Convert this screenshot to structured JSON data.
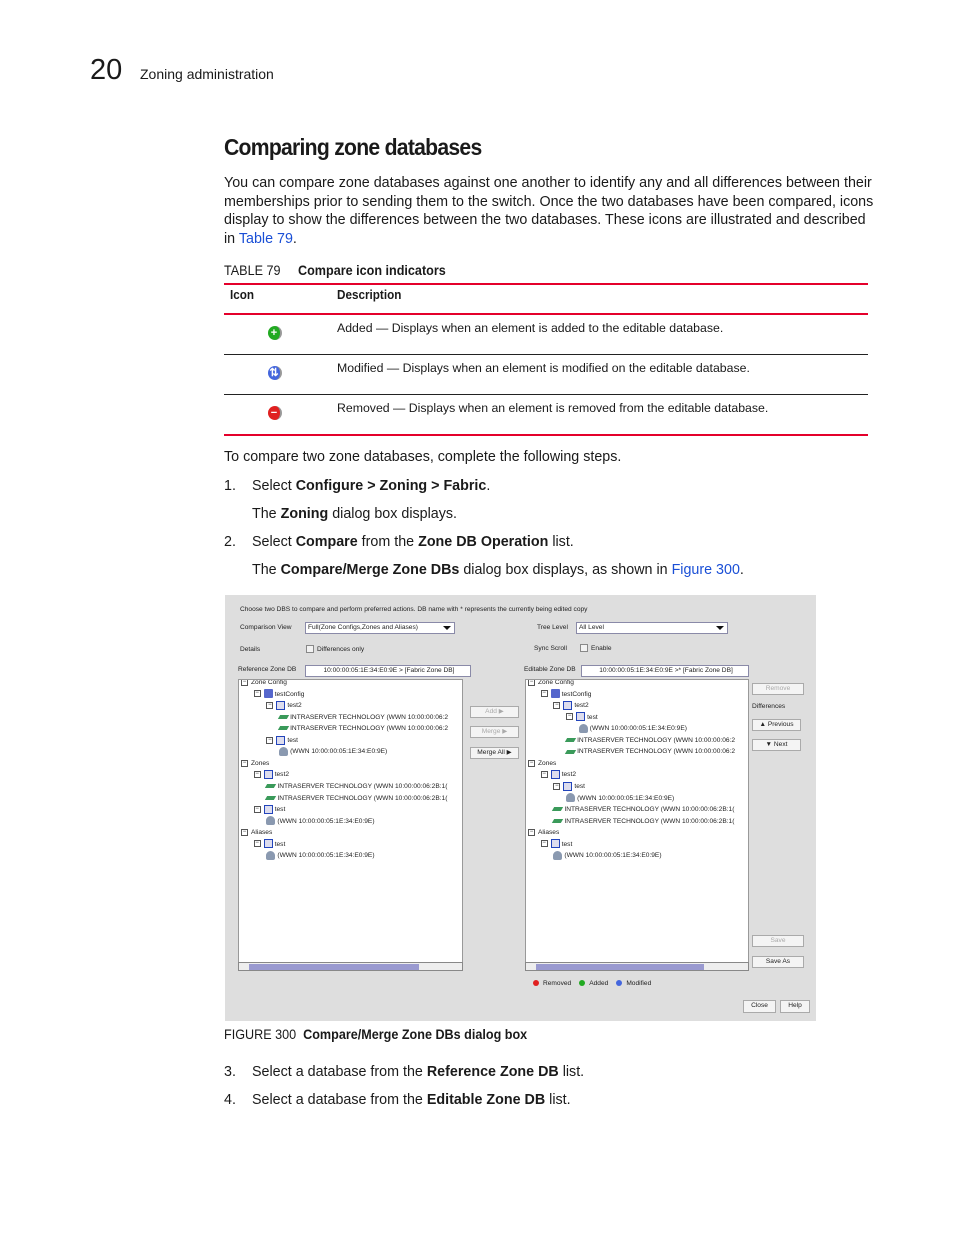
{
  "header": {
    "chapter_number": "20",
    "chapter_title": "Zoning administration"
  },
  "section_title": "Comparing zone databases",
  "intro": {
    "text": "You can compare zone databases against one another to identify any and all differences between their memberships prior to sending them to the switch. Once the two databases have been compared, icons display to show the differences between the two databases. These icons are illustrated and described in ",
    "link": "Table 79",
    "end": "."
  },
  "table": {
    "label": "TABLE 79",
    "title": "Compare icon indicators",
    "headers": [
      "Icon",
      "Description"
    ],
    "rows": [
      {
        "icon": "added-icon",
        "color": "#22aa22",
        "glyph": "+",
        "description": "Added — Displays when an element is added to the editable database."
      },
      {
        "icon": "modified-icon",
        "color": "#4466dd",
        "glyph": "⇅",
        "description": "Modified — Displays when an element is modified on the editable database."
      },
      {
        "icon": "removed-icon",
        "color": "#e02020",
        "glyph": "−",
        "description": "Removed — Displays when an element is removed from the editable database."
      }
    ]
  },
  "steps_intro": "To compare two zone databases, complete the following steps.",
  "steps": [
    {
      "num": "1.",
      "a": "Select ",
      "b": "Configure > Zoning > Fabric",
      "c": "."
    },
    {
      "sub_a": "The ",
      "sub_b": "Zoning",
      "sub_c": " dialog box displays."
    },
    {
      "num": "2.",
      "a": "Select ",
      "b": "Compare",
      "c": " from the ",
      "d": "Zone DB Operation",
      "e": " list."
    },
    {
      "sub_a": "The ",
      "sub_b": "Compare/Merge Zone DBs",
      "sub_c": " dialog box displays, as shown in ",
      "link": "Figure 300",
      "end": "."
    },
    {
      "num": "3.",
      "a": "Select a database from the ",
      "b": "Reference Zone DB",
      "c": " list."
    },
    {
      "num": "4.",
      "a": "Select a database from the ",
      "b": "Editable Zone DB",
      "c": " list."
    }
  ],
  "figure": {
    "label": "FIGURE 300",
    "caption": "Compare/Merge Zone DBs dialog box"
  },
  "dialog": {
    "instruction": "Choose two DBS to compare and perform preferred actions. DB name with * represents the currently being edited copy",
    "comparison_view_label": "Comparison View",
    "comparison_view_value": "Full(Zone Configs,Zones and Aliases)",
    "tree_level_label": "Tree Level",
    "tree_level_value": "All Level",
    "details_label": "Details",
    "differences_only": "Differences only",
    "sync_scroll_label": "Sync Scroll",
    "enable": "Enable",
    "reference_label": "Reference Zone DB",
    "reference_value": "10:00:00:05:1E:34:E0:9E > [Fabric Zone DB]",
    "editable_label": "Editable Zone DB",
    "editable_value": "10:00:00:05:1E:34:E0:9E >*  [Fabric Zone DB]",
    "buttons": {
      "add": "Add ▶",
      "merge": "Merge ▶",
      "merge_all": "Merge All ▶",
      "remove": "Remove",
      "differences": "Differences",
      "previous": "▲ Previous",
      "next": "▼ Next",
      "save": "Save",
      "save_as": "Save As",
      "close": "Close",
      "help": "Help"
    },
    "legend": [
      {
        "label": "Removed",
        "color": "#e02020"
      },
      {
        "label": "Added",
        "color": "#22aa22"
      },
      {
        "label": "Modified",
        "color": "#4466dd"
      }
    ],
    "left_tree": [
      {
        "d": 0,
        "i": "",
        "t": "Zone Config"
      },
      {
        "d": 1,
        "i": "cfg",
        "t": "testConfig"
      },
      {
        "d": 2,
        "i": "zone",
        "t": "test2"
      },
      {
        "d": 3,
        "i": "dev",
        "t": "INTRASERVER TECHNOLOGY (WWN 10:00:00:06:2"
      },
      {
        "d": 3,
        "i": "dev",
        "t": "INTRASERVER TECHNOLOGY (WWN 10:00:00:06:2"
      },
      {
        "d": 2,
        "i": "zone",
        "t": "test"
      },
      {
        "d": 3,
        "i": "host",
        "t": "(WWN 10:00:00:05:1E:34:E0:9E)"
      },
      {
        "d": 0,
        "i": "",
        "t": "Zones"
      },
      {
        "d": 1,
        "i": "zone",
        "t": "test2"
      },
      {
        "d": 2,
        "i": "dev",
        "t": "INTRASERVER TECHNOLOGY (WWN 10:00:00:06:2B:1("
      },
      {
        "d": 2,
        "i": "dev",
        "t": "INTRASERVER TECHNOLOGY (WWN 10:00:00:06:2B:1("
      },
      {
        "d": 1,
        "i": "zone",
        "t": "test"
      },
      {
        "d": 2,
        "i": "host",
        "t": "(WWN 10:00:00:05:1E:34:E0:9E)"
      },
      {
        "d": 0,
        "i": "",
        "t": "Aliases"
      },
      {
        "d": 1,
        "i": "zone",
        "t": "test"
      },
      {
        "d": 2,
        "i": "host",
        "t": "(WWN 10:00:00:05:1E:34:E0:9E)"
      }
    ],
    "right_tree": [
      {
        "d": 0,
        "i": "",
        "t": "Zone Config"
      },
      {
        "d": 1,
        "i": "cfg",
        "t": "testConfig"
      },
      {
        "d": 2,
        "i": "zone",
        "t": "test2"
      },
      {
        "d": 3,
        "i": "zone",
        "t": "test"
      },
      {
        "d": 4,
        "i": "host",
        "t": "(WWN 10:00:00:05:1E:34:E0:9E)"
      },
      {
        "d": 3,
        "i": "dev",
        "t": "INTRASERVER TECHNOLOGY (WWN 10:00:00:06:2"
      },
      {
        "d": 3,
        "i": "dev",
        "t": "INTRASERVER TECHNOLOGY (WWN 10:00:00:06:2"
      },
      {
        "d": 0,
        "i": "",
        "t": "Zones"
      },
      {
        "d": 1,
        "i": "zone",
        "t": "test2"
      },
      {
        "d": 2,
        "i": "zone",
        "t": "test"
      },
      {
        "d": 3,
        "i": "host",
        "t": "(WWN 10:00:00:05:1E:34:E0:9E)"
      },
      {
        "d": 2,
        "i": "dev",
        "t": "INTRASERVER TECHNOLOGY (WWN 10:00:00:06:2B:1("
      },
      {
        "d": 2,
        "i": "dev",
        "t": "INTRASERVER TECHNOLOGY (WWN 10:00:00:06:2B:1("
      },
      {
        "d": 0,
        "i": "",
        "t": "Aliases"
      },
      {
        "d": 1,
        "i": "zone",
        "t": "test"
      },
      {
        "d": 2,
        "i": "host",
        "t": "(WWN 10:00:00:05:1E:34:E0:9E)"
      }
    ]
  }
}
